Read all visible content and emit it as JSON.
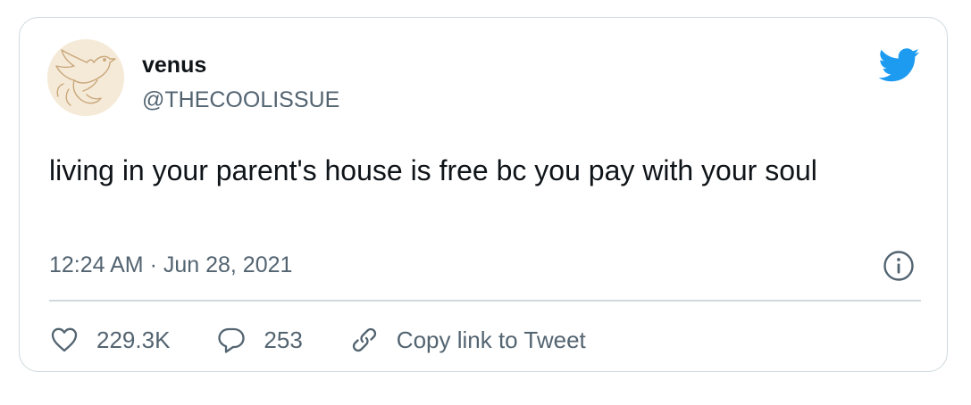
{
  "tweet": {
    "display_name": "venus",
    "handle": "@THECOOLISSUE",
    "text": "living in your parent's house is free bc you pay with your soul",
    "timestamp": "12:24 AM · Jun 28, 2021"
  },
  "actions": {
    "like_count": "229.3K",
    "reply_count": "253",
    "copy_link_label": "Copy link to Tweet"
  },
  "icons": {
    "brand": "twitter-bird-icon",
    "info": "info-icon",
    "like": "heart-icon",
    "reply": "speech-bubble-icon",
    "link": "link-icon"
  },
  "colors": {
    "brand_blue": "#1d9bf0",
    "text_primary": "#0f1419",
    "text_secondary": "#536471",
    "border": "#cfd9de"
  }
}
